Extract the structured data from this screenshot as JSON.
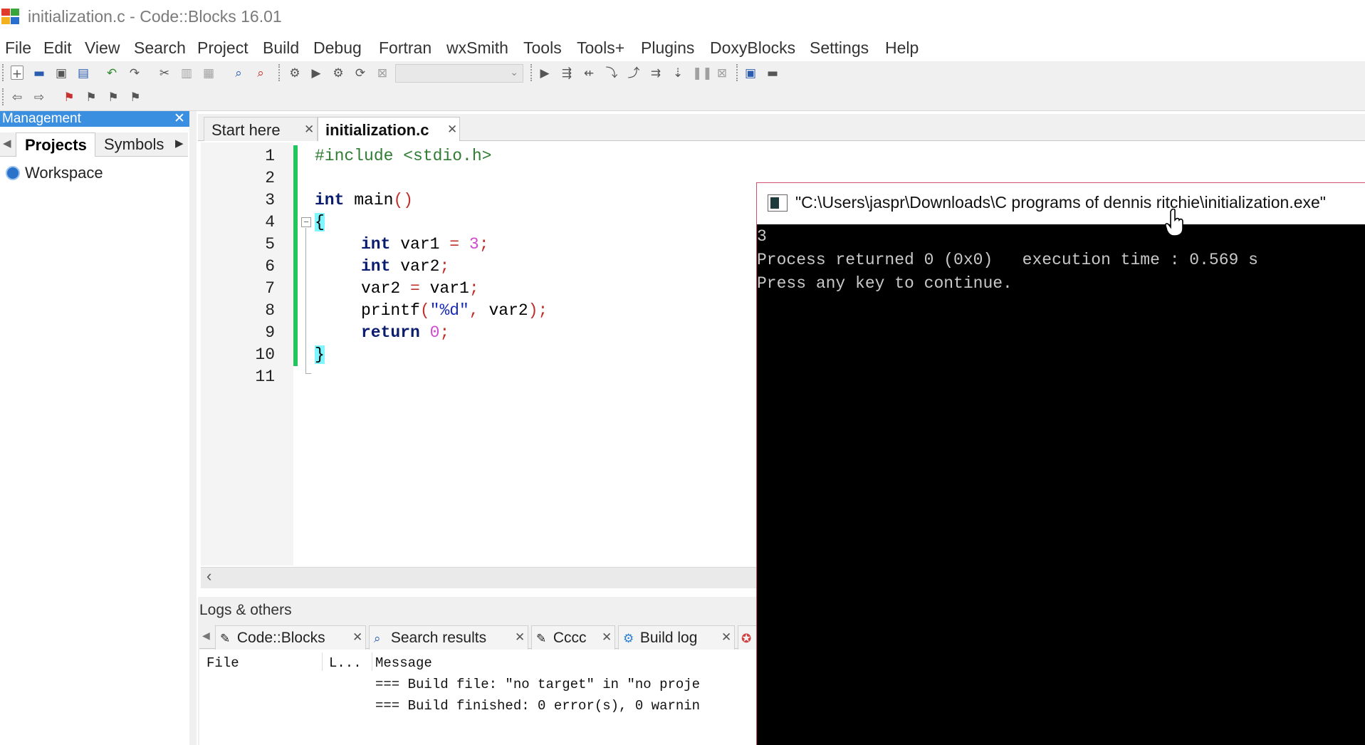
{
  "window": {
    "title": "initialization.c - Code::Blocks 16.01"
  },
  "menu": [
    "File",
    "Edit",
    "View",
    "Search",
    "Project",
    "Build",
    "Debug",
    "Fortran",
    "wxSmith",
    "Tools",
    "Tools+",
    "Plugins",
    "DoxyBlocks",
    "Settings",
    "Help"
  ],
  "toolbar": {
    "icons_row1": [
      "new-file-icon",
      "open-icon",
      "save-icon",
      "save-all-icon",
      "undo-icon",
      "redo-icon",
      "cut-icon",
      "copy-icon",
      "paste-icon",
      "find-icon",
      "replace-icon",
      "build-icon",
      "run-icon",
      "build-run-icon",
      "rebuild-icon",
      "abort-icon",
      "debug-icon",
      "run-to-cursor-icon",
      "next-line-icon",
      "step-into-icon",
      "step-out-icon",
      "next-instruction-icon",
      "step-into-instruction-icon",
      "pause-icon",
      "stop-debugger-icon",
      "debug-windows-icon",
      "info-icon"
    ],
    "icons_row2": [
      "back-icon",
      "forward-icon",
      "toggle-bookmark-icon",
      "prev-bookmark-icon",
      "next-bookmark-icon",
      "clear-bookmarks-icon"
    ],
    "build_target": ""
  },
  "management": {
    "title": "Management",
    "close": "✕",
    "tabs": [
      "Projects",
      "Symbols"
    ],
    "tree": [
      "Workspace"
    ]
  },
  "editor": {
    "tabs": [
      {
        "label": "Start here",
        "active": false
      },
      {
        "label": "initialization.c",
        "active": true
      }
    ],
    "tab_close": "✕",
    "line_numbers": [
      "1",
      "2",
      "3",
      "4",
      "5",
      "6",
      "7",
      "8",
      "9",
      "10",
      "11"
    ],
    "code": {
      "l1": "#include <stdio.h>",
      "l3_kw": "int",
      "l3_rest": " main",
      "l3_parens": "()",
      "l4": "{",
      "l5_kw": "int",
      "l5_a": " var1 ",
      "l5_eq": "=",
      "l5_sp": " ",
      "l5_num": "3",
      "l5_semi": ";",
      "l6_kw": "int",
      "l6_a": " var2",
      "l6_semi": ";",
      "l7_a": "var2 ",
      "l7_eq": "=",
      "l7_b": " var1",
      "l7_semi": ";",
      "l8_a": "printf",
      "l8_p1": "(",
      "l8_str": "\"%d\"",
      "l8_c": ",",
      "l8_b": " var2",
      "l8_p2": ")",
      "l8_semi": ";",
      "l9_kw": "return",
      "l9_sp": " ",
      "l9_num": "0",
      "l9_semi": ";",
      "l10": "}"
    }
  },
  "logs": {
    "title": "Logs & others",
    "tabs": [
      "Code::Blocks",
      "Search results",
      "Cccc",
      "Build log"
    ],
    "columns": [
      "File",
      "L...",
      "Message"
    ],
    "messages": [
      "=== Build file: \"no target\" in \"no proje",
      "=== Build finished: 0 error(s), 0 warnin"
    ]
  },
  "console": {
    "title": "\"C:\\Users\\jaspr\\Downloads\\C programs of dennis ritchie\\initialization.exe\"",
    "lines": [
      "3",
      "Process returned 0 (0x0)   execution time : 0.569 s",
      "Press any key to continue."
    ]
  }
}
